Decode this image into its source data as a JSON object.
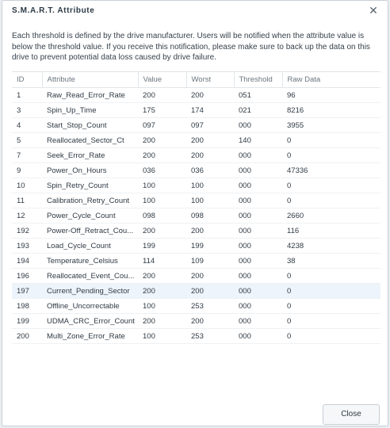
{
  "dialog": {
    "title": "S.M.A.R.T. Attribute",
    "close_icon": "close-icon",
    "description": "Each threshold is defined by the drive manufacturer. Users will be notified when the attribute value is below the threshold value. If you receive this notification, please make sure to back up the data on this drive to prevent potential data loss caused by drive failure."
  },
  "table": {
    "columns": [
      "ID",
      "Attribute",
      "Value",
      "Worst",
      "Threshold",
      "Raw Data"
    ],
    "rows": [
      [
        "1",
        "Raw_Read_Error_Rate",
        "200",
        "200",
        "051",
        "96"
      ],
      [
        "3",
        "Spin_Up_Time",
        "175",
        "174",
        "021",
        "8216"
      ],
      [
        "4",
        "Start_Stop_Count",
        "097",
        "097",
        "000",
        "3955"
      ],
      [
        "5",
        "Reallocated_Sector_Ct",
        "200",
        "200",
        "140",
        "0"
      ],
      [
        "7",
        "Seek_Error_Rate",
        "200",
        "200",
        "000",
        "0"
      ],
      [
        "9",
        "Power_On_Hours",
        "036",
        "036",
        "000",
        "47336"
      ],
      [
        "10",
        "Spin_Retry_Count",
        "100",
        "100",
        "000",
        "0"
      ],
      [
        "11",
        "Calibration_Retry_Count",
        "100",
        "100",
        "000",
        "0"
      ],
      [
        "12",
        "Power_Cycle_Count",
        "098",
        "098",
        "000",
        "2660"
      ],
      [
        "192",
        "Power-Off_Retract_Cou...",
        "200",
        "200",
        "000",
        "116"
      ],
      [
        "193",
        "Load_Cycle_Count",
        "199",
        "199",
        "000",
        "4238"
      ],
      [
        "194",
        "Temperature_Celsius",
        "114",
        "109",
        "000",
        "38"
      ],
      [
        "196",
        "Reallocated_Event_Cou...",
        "200",
        "200",
        "000",
        "0"
      ],
      [
        "197",
        "Current_Pending_Sector",
        "200",
        "200",
        "000",
        "0"
      ],
      [
        "198",
        "Offline_Uncorrectable",
        "100",
        "253",
        "000",
        "0"
      ],
      [
        "199",
        "UDMA_CRC_Error_Count",
        "200",
        "200",
        "000",
        "0"
      ],
      [
        "200",
        "Multi_Zone_Error_Rate",
        "100",
        "253",
        "000",
        "0"
      ]
    ],
    "selected_row": 13
  },
  "footer": {
    "close_label": "Close"
  },
  "colors": {
    "selected_row_bg": "#eef4fb",
    "border": "#c9d0d7"
  }
}
